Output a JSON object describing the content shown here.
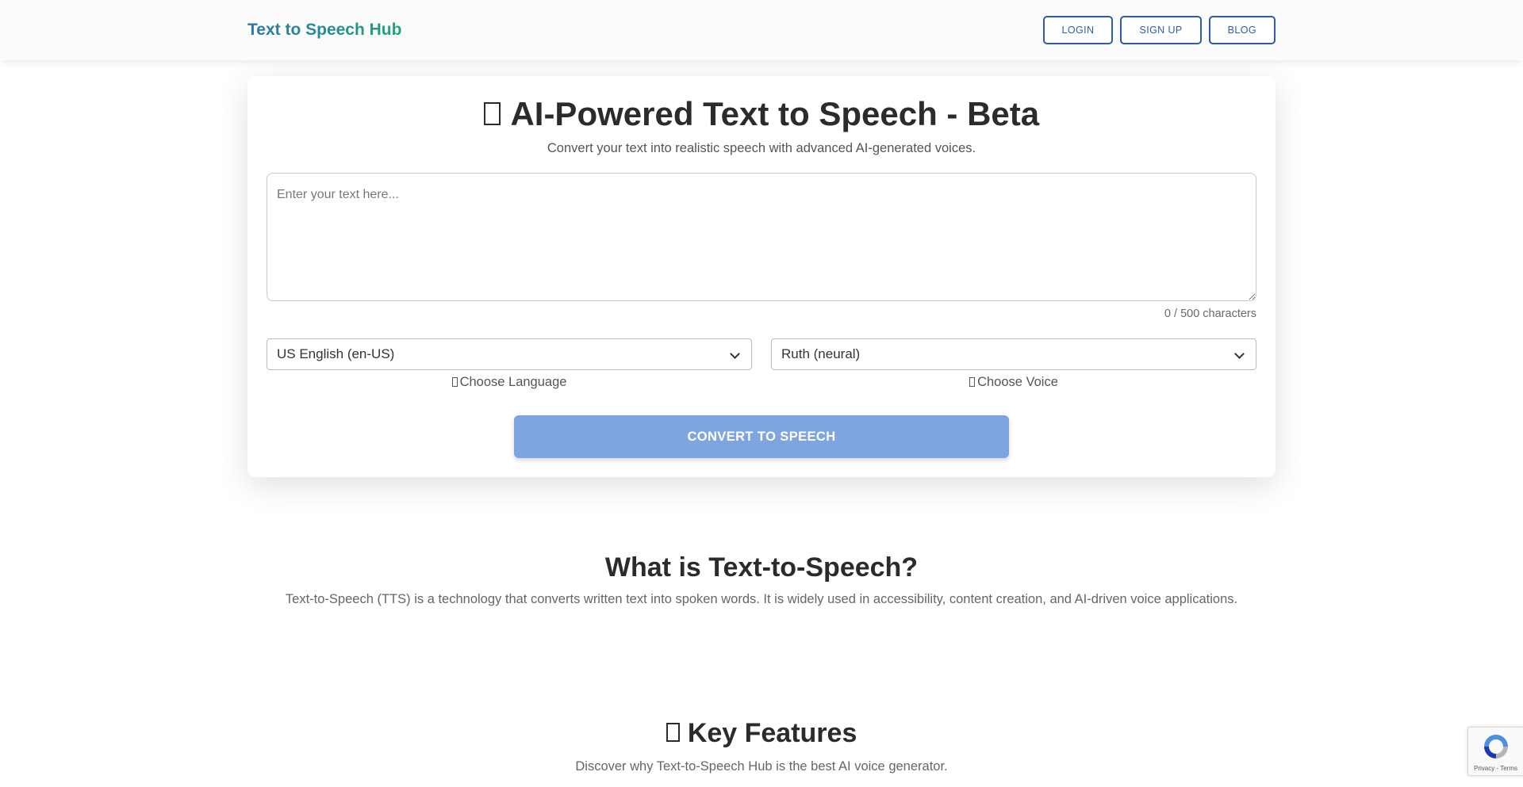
{
  "header": {
    "brand": "Text to Speech Hub",
    "nav": {
      "login": "LOGIN",
      "signup": "SIGN UP",
      "blog": "BLOG"
    }
  },
  "converter": {
    "title": "AI-Powered Text to Speech - Beta",
    "subtitle": "Convert your text into realistic speech with advanced AI-generated voices.",
    "textarea_placeholder": "Enter your text here...",
    "char_count": "0 / 500 characters",
    "language_selected": "US English (en-US)",
    "language_label": "Choose Language",
    "voice_selected": "Ruth (neural)",
    "voice_label": "Choose Voice",
    "convert_label": "CONVERT TO SPEECH"
  },
  "what_is": {
    "title": "What is Text-to-Speech?",
    "text": "Text-to-Speech (TTS) is a technology that converts written text into spoken words. It is widely used in accessibility, content creation, and AI-driven voice applications."
  },
  "features": {
    "title": "Key Features",
    "text": "Discover why Text-to-Speech Hub is the best AI voice generator."
  },
  "recaptcha": {
    "links": "Privacy - Terms"
  },
  "colors": {
    "brand_start": "#2a79a6",
    "brand_end": "#1fa37a",
    "nav_border": "#2f5aa8",
    "convert_button": "#7fa5e1"
  },
  "icons": {
    "title_icon": "missing-glyph-icon",
    "language_icon": "missing-glyph-icon",
    "voice_icon": "missing-glyph-icon",
    "features_icon": "missing-glyph-icon",
    "recaptcha_icon": "recaptcha-logo-icon"
  }
}
